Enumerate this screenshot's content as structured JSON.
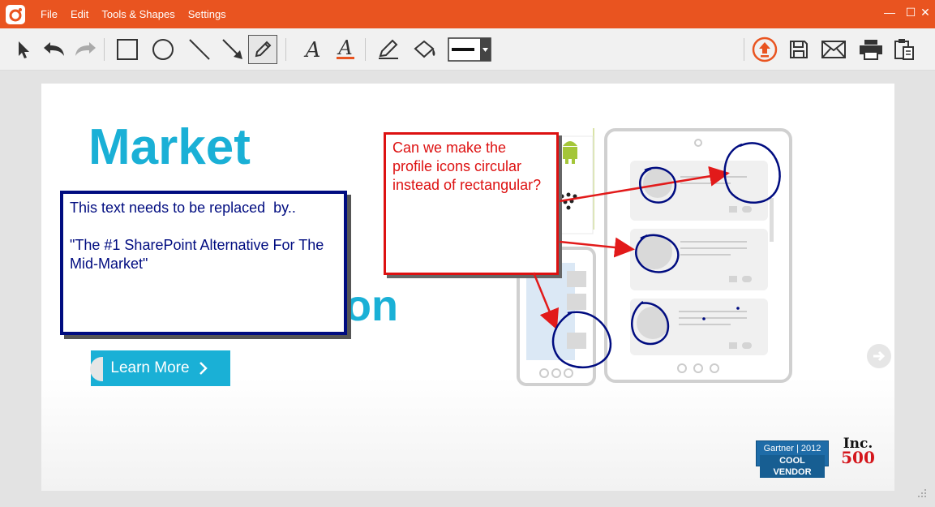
{
  "menu": {
    "items": [
      "File",
      "Edit",
      "Tools & Shapes",
      "Settings"
    ]
  },
  "window_controls": {
    "minimize": "—",
    "maximize": "☐",
    "close": "✕"
  },
  "toolbar": {
    "tools": [
      "select-arrow",
      "undo",
      "redo",
      "rectangle",
      "ellipse",
      "line",
      "arrow",
      "pencil",
      "text",
      "text-color",
      "highlighter",
      "fill-bucket",
      "line-width"
    ],
    "active_tool": "pencil",
    "actions": [
      "upload",
      "save",
      "email",
      "print",
      "clipboard"
    ]
  },
  "slide": {
    "headline_word": "Market",
    "headline_tail": "on",
    "learn_more": "Learn More"
  },
  "annotations": {
    "blue_note": "This text needs to be replaced  by..\n\n\"The #1 SharePoint Alternative For The  Mid-Market\"",
    "red_note": "Can we make the profile icons circular instead of rectangular?"
  },
  "badges": {
    "gartner_line1": "Gartner | 2012",
    "gartner_line2": "COOL VENDOR",
    "inc_word": "Inc.",
    "inc_number": "500"
  },
  "colors": {
    "titlebar": "#e95420",
    "brand_blue": "#1ab0d6",
    "note_blue": "#000c80",
    "note_red": "#dd1111",
    "upload_accent": "#e95420"
  }
}
